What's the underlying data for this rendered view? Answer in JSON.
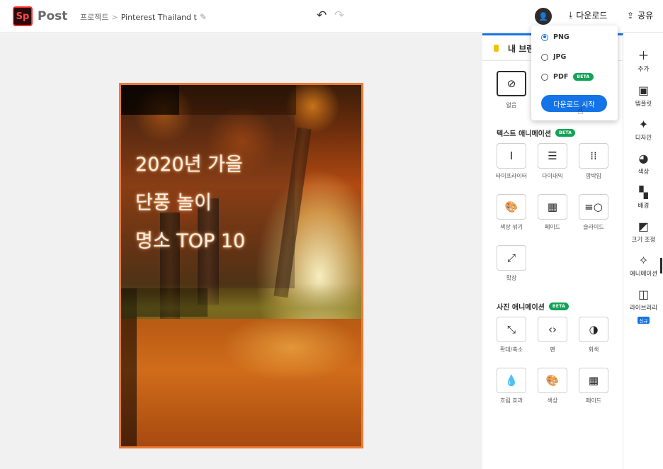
{
  "app": {
    "logo": "Sp",
    "name": "Post"
  },
  "breadcrumb": {
    "root": "프로젝트",
    "separator": ">",
    "project": "Pinterest Thailand t"
  },
  "header": {
    "undo_icon": "undo-icon",
    "redo_icon": "redo-icon",
    "download_label": "다운로드",
    "share_label": "공유"
  },
  "poster": {
    "title_lines": [
      "2020년 가을",
      "단풍 놀이",
      "명소 TOP 10"
    ],
    "border_color": "#ec7a33"
  },
  "panel": {
    "brand_label": "내 브랜",
    "none_label": "없음",
    "text_anim": {
      "title": "텍스트 애니메이션",
      "badge": "BETA",
      "items": [
        {
          "label": "타이프라이터",
          "icon": "typewriter-icon"
        },
        {
          "label": "다이내믹",
          "icon": "dynamic-icon"
        },
        {
          "label": "깜박임",
          "icon": "flicker-icon"
        },
        {
          "label": "색상 섞기",
          "icon": "palette-icon"
        },
        {
          "label": "페이드",
          "icon": "fade-icon"
        },
        {
          "label": "슬라이드",
          "icon": "slide-icon"
        },
        {
          "label": "확장",
          "icon": "expand-icon"
        }
      ]
    },
    "photo_anim": {
      "title": "사진 애니메이션",
      "badge": "BETA",
      "items": [
        {
          "label": "확대/축소",
          "icon": "zoom-icon"
        },
        {
          "label": "팬",
          "icon": "pan-icon"
        },
        {
          "label": "회색",
          "icon": "grayscale-icon"
        },
        {
          "label": "흐림 효과",
          "icon": "blur-icon"
        },
        {
          "label": "색상",
          "icon": "color-icon"
        },
        {
          "label": "페이드",
          "icon": "fade-icon"
        }
      ]
    }
  },
  "rail": {
    "items": [
      {
        "label": "추가",
        "icon": "plus-icon"
      },
      {
        "label": "템플릿",
        "icon": "template-icon"
      },
      {
        "label": "디자인",
        "icon": "design-wand-icon"
      },
      {
        "label": "색상",
        "icon": "palette-icon"
      },
      {
        "label": "배경",
        "icon": "layout-icon"
      },
      {
        "label": "크기 조정",
        "icon": "resize-icon"
      },
      {
        "label": "애니메이션",
        "icon": "animation-icon"
      },
      {
        "label": "라이브러리",
        "icon": "library-icon",
        "badge": "신규"
      }
    ],
    "active": "애니메이션"
  },
  "download_menu": {
    "options": [
      {
        "label": "PNG",
        "selected": true
      },
      {
        "label": "JPG",
        "selected": false
      },
      {
        "label": "PDF",
        "selected": false,
        "badge": "BETA"
      }
    ],
    "start_label": "다운로드 시작",
    "accent": "#1473e6"
  }
}
